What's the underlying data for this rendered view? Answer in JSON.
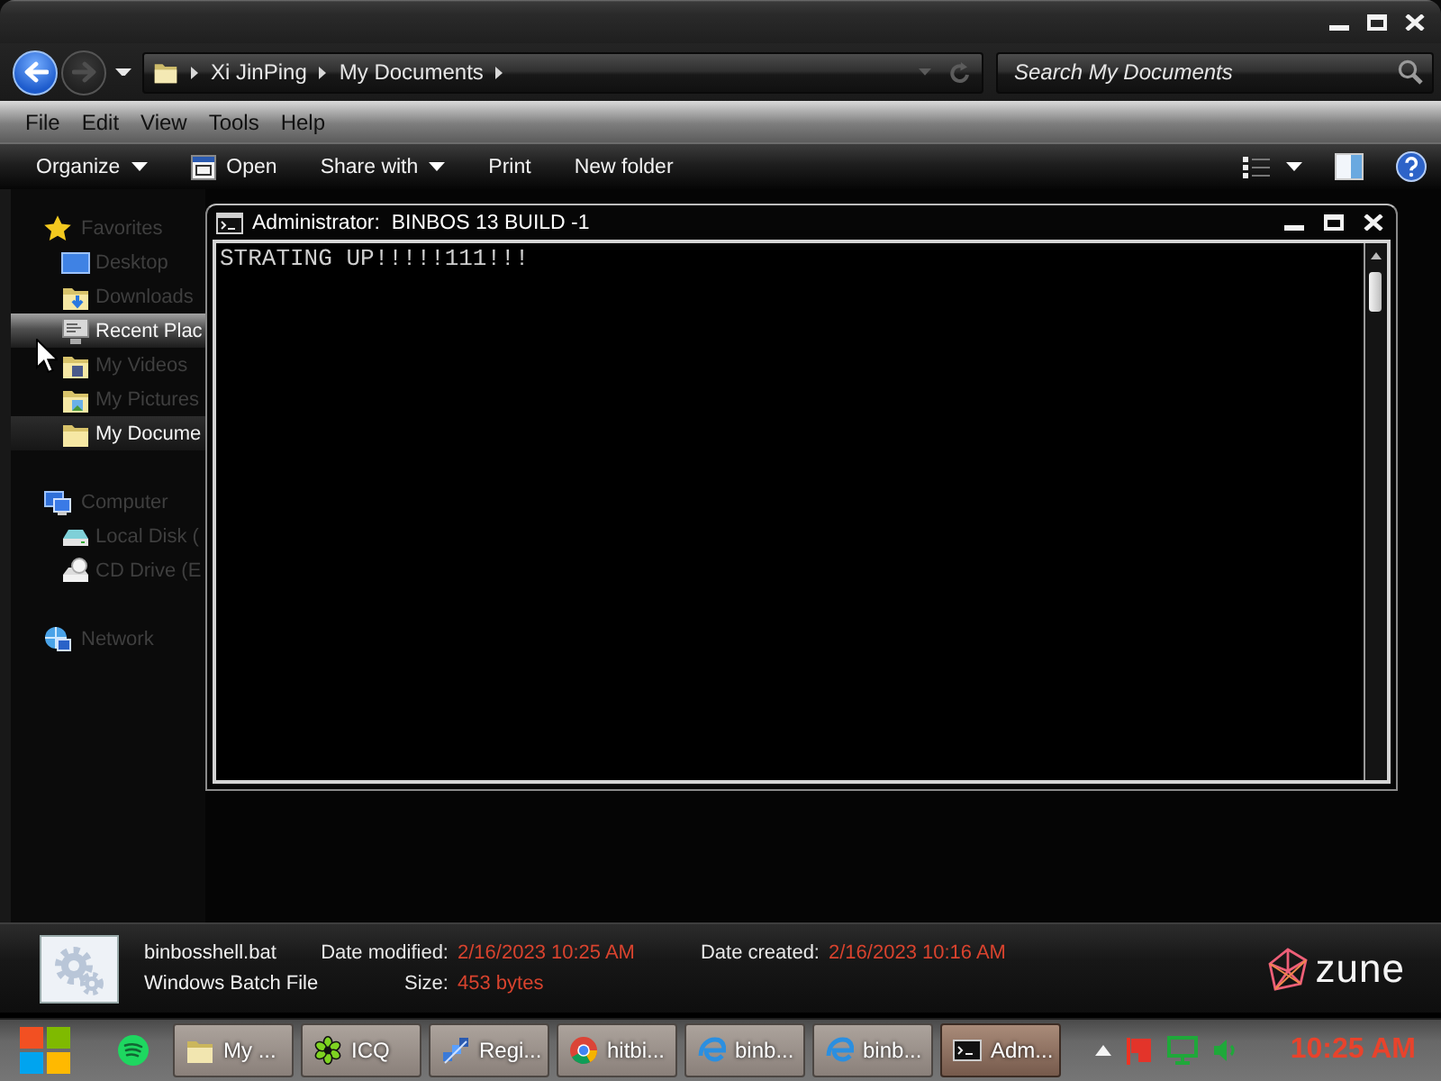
{
  "navigation": {
    "back": {
      "disabled": false
    },
    "forward": {
      "disabled": true
    }
  },
  "address_bar": {
    "path": [
      "Xi JinPing",
      "My Documents"
    ]
  },
  "search": {
    "placeholder": "Search My Documents"
  },
  "menu": [
    "File",
    "Edit",
    "View",
    "Tools",
    "Help"
  ],
  "toolbar": [
    {
      "label": "Organize",
      "kind": "menu"
    },
    {
      "label": "Open",
      "kind": "app"
    },
    {
      "label": "Share with",
      "kind": "menu"
    },
    {
      "label": "Print",
      "kind": "plain"
    },
    {
      "label": "New folder",
      "kind": "plain"
    }
  ],
  "sidebar": [
    {
      "label": "Favorites",
      "kind": "favorites",
      "selected": false,
      "highlighted": false,
      "children": [
        {
          "label": "Desktop",
          "kind": "desktop",
          "selected": false,
          "highlighted": false
        },
        {
          "label": "Downloads",
          "kind": "downloads",
          "selected": false,
          "highlighted": false
        },
        {
          "label": "Recent Plac",
          "kind": "recent",
          "selected": false,
          "highlighted": true
        },
        {
          "label": "My Videos",
          "kind": "videos",
          "selected": false,
          "highlighted": false
        },
        {
          "label": "My Pictures",
          "kind": "pictures",
          "selected": false,
          "highlighted": false
        },
        {
          "label": "My Docume",
          "kind": "documents",
          "selected": true,
          "highlighted": false
        }
      ]
    },
    {
      "label": "Computer",
      "kind": "computer",
      "selected": false,
      "highlighted": false,
      "children": [
        {
          "label": "Local Disk (",
          "kind": "drive",
          "selected": false,
          "highlighted": false
        },
        {
          "label": "CD Drive (E",
          "kind": "disc",
          "selected": false,
          "highlighted": false
        }
      ]
    },
    {
      "label": "Network",
      "kind": "network",
      "selected": false,
      "highlighted": false
    }
  ],
  "console": {
    "title": "Administrator:  BINBOS 13 BUILD -1",
    "lines": [
      "STRATING UP!!!!!111!!!"
    ]
  },
  "details": {
    "lines": [
      {
        "text": "binbosshell.bat",
        "fields": [
          {
            "label": "Date modified:",
            "value": "2/16/2023 10:25 AM"
          },
          {
            "label": "Date created:",
            "value": "2/16/2023 10:16 AM"
          }
        ]
      },
      {
        "text": "Windows Batch File",
        "fields": [
          {
            "label": "Size:",
            "value": "453 bytes"
          }
        ]
      }
    ],
    "logo": "zune"
  },
  "taskbar": {
    "buttons": [
      {
        "label": "My ...",
        "kind": "folder",
        "selected": false
      },
      {
        "label": "ICQ",
        "kind": "flower",
        "selected": false
      },
      {
        "label": "Regi...",
        "kind": "cubes",
        "selected": false
      },
      {
        "label": "hitbi...",
        "kind": "browser",
        "selected": false
      },
      {
        "label": "binb...",
        "kind": "swirl",
        "selected": false
      },
      {
        "label": "binb...",
        "kind": "swirl",
        "selected": false
      },
      {
        "label": "Adm...",
        "kind": "console",
        "selected": true
      }
    ],
    "clock": "10:25 AM"
  }
}
